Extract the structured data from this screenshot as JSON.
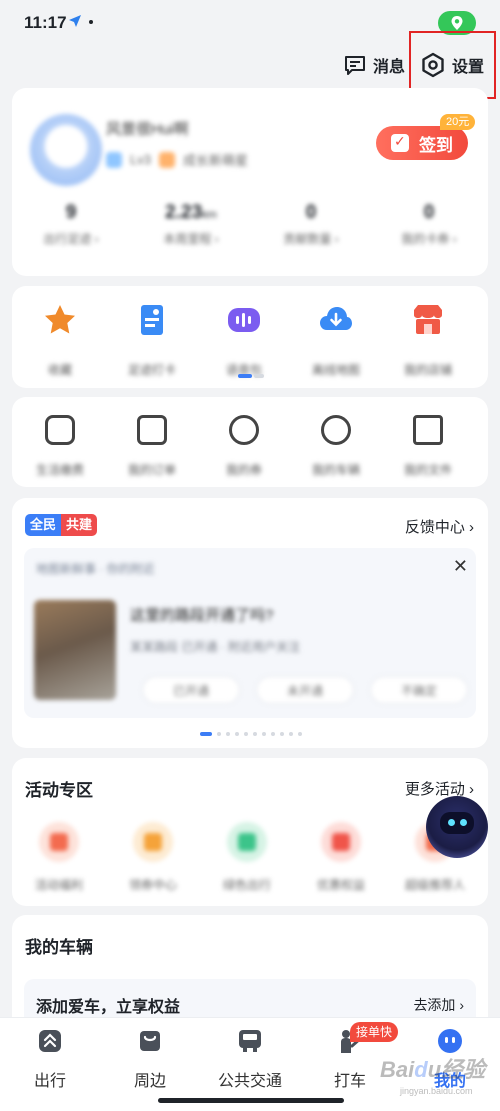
{
  "status_bar": {
    "time": "11:17"
  },
  "top_actions": {
    "messages_label": "消息",
    "settings_label": "设置"
  },
  "profile": {
    "username": "风景很Hui啊",
    "tag_1": "Lv3",
    "tag_2": "成长新萌星",
    "checkin_label": "签到",
    "checkin_reward": "20元",
    "stats": [
      {
        "value": "9",
        "label": "出行足迹 ›"
      },
      {
        "value": "2.23",
        "unit": "km",
        "label": "本周里程 ›"
      },
      {
        "value": "0",
        "label": "贡献数量 ›"
      },
      {
        "value": "0",
        "label": "我的卡券 ›"
      }
    ]
  },
  "shortcuts": [
    {
      "label": "收藏",
      "icon": "star-icon",
      "color": "#f08a2b"
    },
    {
      "label": "足迹打卡",
      "icon": "map-note-icon",
      "color": "#3a8bf5"
    },
    {
      "label": "语音包",
      "icon": "voice-wave-icon",
      "color": "#7b5cf0"
    },
    {
      "label": "离线地图",
      "icon": "cloud-download-icon",
      "color": "#3a8bf5"
    },
    {
      "label": "我的店铺",
      "icon": "shop-icon",
      "color": "#f05a46"
    }
  ],
  "services": [
    {
      "label": "生活缴费",
      "icon": "bill-icon"
    },
    {
      "label": "我的订单",
      "icon": "wallet-icon"
    },
    {
      "label": "我的券",
      "icon": "coupon-icon"
    },
    {
      "label": "我的车辆",
      "icon": "car-icon"
    },
    {
      "label": "我的文件",
      "icon": "folder-icon"
    }
  ],
  "community": {
    "badge_left": "全民",
    "badge_right": "共建",
    "feedback_label": "反馈中心",
    "feed_source": "地图新鲜事 · 你的附近",
    "feed_title": "这里的路段开通了吗?",
    "feed_meta": "某某路段 已开通 · 附近用户关注",
    "chips": [
      "已开通",
      "未开通",
      "不确定"
    ]
  },
  "activities": {
    "title": "活动专区",
    "more_label": "更多活动",
    "items": [
      {
        "label": "活动福利",
        "color": "#f36b4f"
      },
      {
        "label": "领券中心",
        "color": "#f5a33a"
      },
      {
        "label": "绿色出行",
        "color": "#3cc48a"
      },
      {
        "label": "优惠权益",
        "color": "#f0554a"
      },
      {
        "label": "超级推荐人",
        "color": "#f26a4a"
      }
    ]
  },
  "vehicles": {
    "title": "我的车辆",
    "promo": "添加爱车，立享权益",
    "add_label": "去添加"
  },
  "tabbar": {
    "items": [
      {
        "label": "出行",
        "icon": "travel-icon"
      },
      {
        "label": "周边",
        "icon": "nearby-bag-icon"
      },
      {
        "label": "公共交通",
        "icon": "bus-icon"
      },
      {
        "label": "打车",
        "icon": "taxi-person-icon"
      },
      {
        "label": "我的",
        "icon": "profile-face-icon"
      }
    ],
    "taxi_badge": "接单快",
    "active_index": 4
  },
  "colors": {
    "accent": "#3471f2",
    "checkin": "#f24a3d",
    "highlight": "#e12424"
  }
}
